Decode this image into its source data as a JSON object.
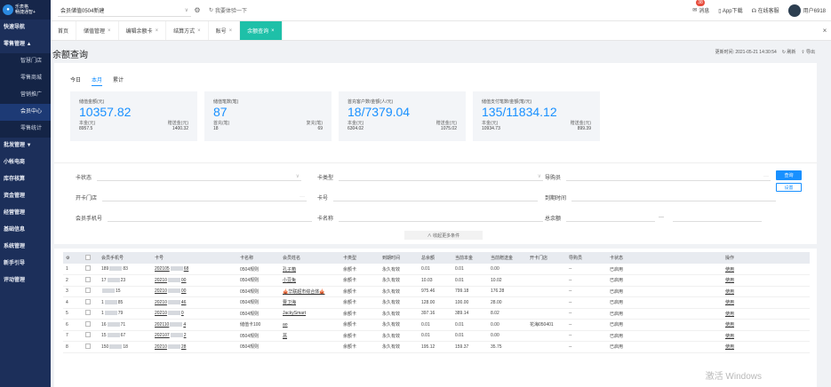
{
  "brand": {
    "line1": "乐表格",
    "line2": "畅捷通智+"
  },
  "sidebar": {
    "items": [
      {
        "label": "快速导航",
        "type": "group"
      },
      {
        "label": "零售管理 ▲",
        "type": "group"
      },
      {
        "label": "智慧门店",
        "type": "sub"
      },
      {
        "label": "零售商城",
        "type": "sub"
      },
      {
        "label": "营销推广",
        "type": "sub"
      },
      {
        "label": "会员中心",
        "type": "sub",
        "active": true
      },
      {
        "label": "零售统计",
        "type": "sub"
      },
      {
        "label": "批发管理 ▼",
        "type": "group"
      },
      {
        "label": "小帐电商",
        "type": "group"
      },
      {
        "label": "库存核算",
        "type": "group"
      },
      {
        "label": "资金管理",
        "type": "group"
      },
      {
        "label": "经营管理",
        "type": "group"
      },
      {
        "label": "基础信息",
        "type": "group"
      },
      {
        "label": "系统管理",
        "type": "group"
      },
      {
        "label": "新手引导",
        "type": "group"
      },
      {
        "label": "评动管理",
        "type": "group"
      }
    ]
  },
  "topbar": {
    "store": "会员储值0504新建",
    "try_new": "我要体验一下",
    "msg_label": "消息",
    "msg_count": "38",
    "app_download": "App下载",
    "online_service": "在线客服",
    "user": "用户6918"
  },
  "tabs": [
    {
      "label": "首页",
      "closable": false
    },
    {
      "label": "储值管理",
      "closable": true
    },
    {
      "label": "编辑余额卡",
      "closable": true
    },
    {
      "label": "结算方式",
      "closable": true
    },
    {
      "label": "账号",
      "closable": true
    },
    {
      "label": "余额查询",
      "closable": true,
      "active": true
    }
  ],
  "page": {
    "title": "余额查询",
    "updated": "更新时间: 2021-05-21 14:30:54",
    "refresh": "刷新",
    "export": "导出"
  },
  "subtabs": [
    "今日",
    "本月",
    "累计"
  ],
  "cards": [
    {
      "label": "储值金额(元)",
      "value": "10357.82",
      "k1": "本金(元)",
      "k2": "赠送金(元)",
      "v1": "8957.5",
      "v2": "1400.32"
    },
    {
      "label": "储值笔数(笔)",
      "value": "87",
      "k1": "首充(笔)",
      "k2": "复充(笔)",
      "v1": "18",
      "v2": "69"
    },
    {
      "label": "首充客户数/金额(人/元)",
      "value": "18/7379.04",
      "k1": "本金(元)",
      "k2": "赠送金(元)",
      "v1": "6304.02",
      "v2": "1075.02"
    },
    {
      "label": "储值支付笔数/金额(笔/元)",
      "value": "135/11834.12",
      "k1": "本金(元)",
      "k2": "赠送金(元)",
      "v1": "10934.73",
      "v2": "899.39"
    }
  ],
  "filters": {
    "card_status": "卡状态",
    "card_type": "卡类型",
    "guide": "导购员",
    "open_store": "开卡门店",
    "card_no": "卡号",
    "expire": "到期时间",
    "member_phone": "会员手机号",
    "card_name": "卡名称",
    "total_balance": "总余额",
    "dash": "—",
    "ellipsis": "···",
    "query": "查询",
    "settings": "设置",
    "collapse": "∧ 收起更多条件"
  },
  "table": {
    "headers": [
      "",
      "",
      "会员手机号",
      "卡号",
      "卡名称",
      "会员姓名",
      "卡类型",
      "到期时间",
      "总余额",
      "当前本金",
      "当前赠送金",
      "开卡门店",
      "导购员",
      "卡状态",
      "操作"
    ],
    "rows": [
      [
        "1",
        "189",
        "83",
        "202105",
        "68",
        "0504规则",
        "孔子箱",
        "余额卡",
        "永久有效",
        "0.01",
        "0.01",
        "0.00",
        "",
        "--",
        "已启用",
        "使用"
      ],
      [
        "2",
        "17",
        "23",
        "20210",
        "00",
        "0504规则",
        "小豆兔",
        "余额卡",
        "永久有效",
        "10.03",
        "0.01",
        "10.02",
        "",
        "--",
        "已启用",
        "使用"
      ],
      [
        "3",
        "",
        "15",
        "20210",
        "00",
        "0504规则",
        "🎪华联超市综合体🎪",
        "余额卡",
        "永久有效",
        "975.46",
        "799.18",
        "176.28",
        "",
        "--",
        "已启用",
        "使用"
      ],
      [
        "4",
        "1",
        "85",
        "20210",
        "46",
        "0504规则",
        "曹卫海",
        "余额卡",
        "永久有效",
        "128.00",
        "100.00",
        "28.00",
        "",
        "--",
        "已启用",
        "使用"
      ],
      [
        "5",
        "1",
        "79",
        "20210",
        "0",
        "0504规则",
        "JackySmart",
        "余额卡",
        "永久有效",
        "397.16",
        "389.14",
        "8.02",
        "",
        "--",
        "已启用",
        "使用"
      ],
      [
        "6",
        "16",
        "71",
        "202110",
        "4",
        "储值卡100",
        "ao",
        "余额卡",
        "永久有效",
        "0.01",
        "0.01",
        "0.00",
        "花海050401",
        "--",
        "已启用",
        "使用"
      ],
      [
        "7",
        "15",
        "67",
        "202107",
        "2",
        "0504规则",
        "菖",
        "余额卡",
        "永久有效",
        "0.01",
        "0.01",
        "0.00",
        "",
        "--",
        "已启用",
        "使用"
      ],
      [
        "8",
        "150",
        "18",
        "20210",
        "28",
        "0504规则",
        "",
        "余额卡",
        "永久有效",
        "195.12",
        "159.37",
        "35.75",
        "",
        "--",
        "已启用",
        "使用"
      ]
    ]
  },
  "watermark": "激活 Windows"
}
